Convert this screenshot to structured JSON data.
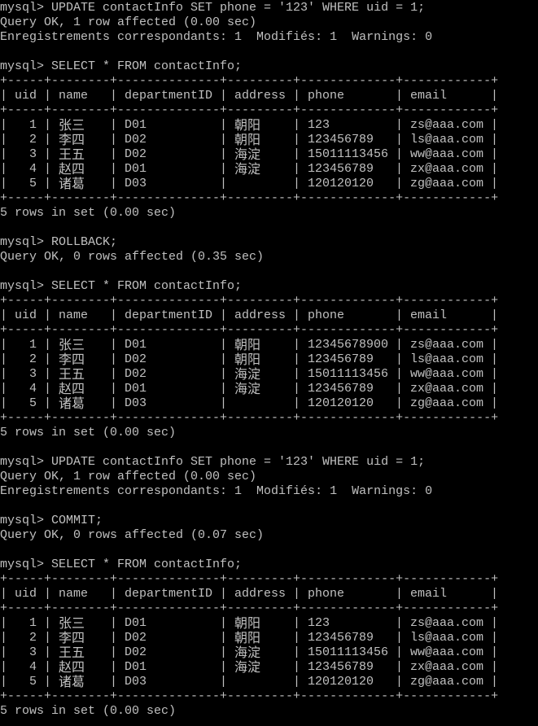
{
  "terminal": {
    "background": "#000000",
    "foreground": "#c0c0c0",
    "prompt": "mysql>",
    "session": [
      {
        "kind": "command",
        "text": "UPDATE contactInfo SET phone = '123' WHERE uid = 1;"
      },
      {
        "kind": "output",
        "text": "Query OK, 1 row affected (0.00 sec)"
      },
      {
        "kind": "output",
        "text": "Enregistrements correspondants: 1  Modifiés: 1  Warnings: 0"
      },
      {
        "kind": "blank"
      },
      {
        "kind": "command",
        "text": "SELECT * FROM contactInfo;"
      },
      {
        "kind": "table",
        "table": 0
      },
      {
        "kind": "output",
        "text": "5 rows in set (0.00 sec)"
      },
      {
        "kind": "blank"
      },
      {
        "kind": "command",
        "text": "ROLLBACK;"
      },
      {
        "kind": "output",
        "text": "Query OK, 0 rows affected (0.35 sec)"
      },
      {
        "kind": "blank"
      },
      {
        "kind": "command",
        "text": "SELECT * FROM contactInfo;"
      },
      {
        "kind": "table",
        "table": 1
      },
      {
        "kind": "output",
        "text": "5 rows in set (0.00 sec)"
      },
      {
        "kind": "blank"
      },
      {
        "kind": "command",
        "text": "UPDATE contactInfo SET phone = '123' WHERE uid = 1;"
      },
      {
        "kind": "output",
        "text": "Query OK, 1 row affected (0.00 sec)"
      },
      {
        "kind": "output",
        "text": "Enregistrements correspondants: 1  Modifiés: 1  Warnings: 0"
      },
      {
        "kind": "blank"
      },
      {
        "kind": "command",
        "text": "COMMIT;"
      },
      {
        "kind": "output",
        "text": "Query OK, 0 rows affected (0.07 sec)"
      },
      {
        "kind": "blank"
      },
      {
        "kind": "command",
        "text": "SELECT * FROM contactInfo;"
      },
      {
        "kind": "table",
        "table": 2
      },
      {
        "kind": "output",
        "text": "5 rows in set (0.00 sec)"
      }
    ],
    "tables": [
      {
        "columns": [
          "uid",
          "name",
          "departmentID",
          "address",
          "phone",
          "email"
        ],
        "rows": [
          [
            "1",
            "张三",
            "D01",
            "朝阳",
            "123",
            "zs@aaa.com"
          ],
          [
            "2",
            "李四",
            "D02",
            "朝阳",
            "123456789",
            "ls@aaa.com"
          ],
          [
            "3",
            "王五",
            "D02",
            "海淀",
            "15011113456",
            "ww@aaa.com"
          ],
          [
            "4",
            "赵四",
            "D01",
            "海淀",
            "123456789",
            "zx@aaa.com"
          ],
          [
            "5",
            "诸葛",
            "D03",
            "",
            "120120120",
            "zg@aaa.com"
          ]
        ]
      },
      {
        "columns": [
          "uid",
          "name",
          "departmentID",
          "address",
          "phone",
          "email"
        ],
        "rows": [
          [
            "1",
            "张三",
            "D01",
            "朝阳",
            "12345678900",
            "zs@aaa.com"
          ],
          [
            "2",
            "李四",
            "D02",
            "朝阳",
            "123456789",
            "ls@aaa.com"
          ],
          [
            "3",
            "王五",
            "D02",
            "海淀",
            "15011113456",
            "ww@aaa.com"
          ],
          [
            "4",
            "赵四",
            "D01",
            "海淀",
            "123456789",
            "zx@aaa.com"
          ],
          [
            "5",
            "诸葛",
            "D03",
            "",
            "120120120",
            "zg@aaa.com"
          ]
        ]
      },
      {
        "columns": [
          "uid",
          "name",
          "departmentID",
          "address",
          "phone",
          "email"
        ],
        "rows": [
          [
            "1",
            "张三",
            "D01",
            "朝阳",
            "123",
            "zs@aaa.com"
          ],
          [
            "2",
            "李四",
            "D02",
            "朝阳",
            "123456789",
            "ls@aaa.com"
          ],
          [
            "3",
            "王五",
            "D02",
            "海淀",
            "15011113456",
            "ww@aaa.com"
          ],
          [
            "4",
            "赵四",
            "D01",
            "海淀",
            "123456789",
            "zx@aaa.com"
          ],
          [
            "5",
            "诸葛",
            "D03",
            "",
            "120120120",
            "zg@aaa.com"
          ]
        ]
      }
    ]
  }
}
